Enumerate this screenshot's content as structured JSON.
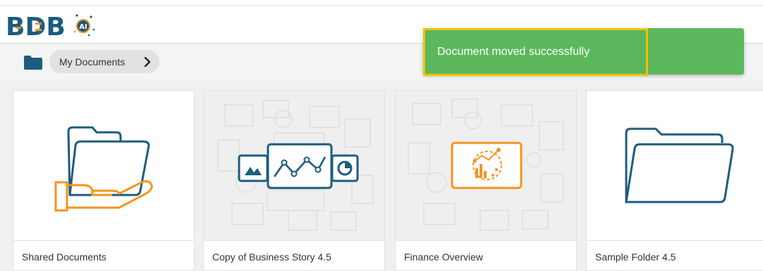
{
  "brand": {
    "name": "BDB",
    "badge": "AI"
  },
  "breadcrumb": {
    "items": [
      {
        "label": "My Documents"
      }
    ]
  },
  "toast": {
    "message": "Document moved successfully"
  },
  "cards": [
    {
      "label": "Shared Documents",
      "icon": "shared-folder-hand-icon"
    },
    {
      "label": "Copy of Business Story 4.5",
      "icon": "business-story-icon"
    },
    {
      "label": "Finance Overview",
      "icon": "dashboard-icon"
    },
    {
      "label": "Sample Folder 4.5",
      "icon": "folder-icon"
    }
  ],
  "colors": {
    "accent": "#1c5c7e",
    "orange": "#f7931e",
    "toast": "#5cb85c",
    "highlight": "#f2c200"
  }
}
